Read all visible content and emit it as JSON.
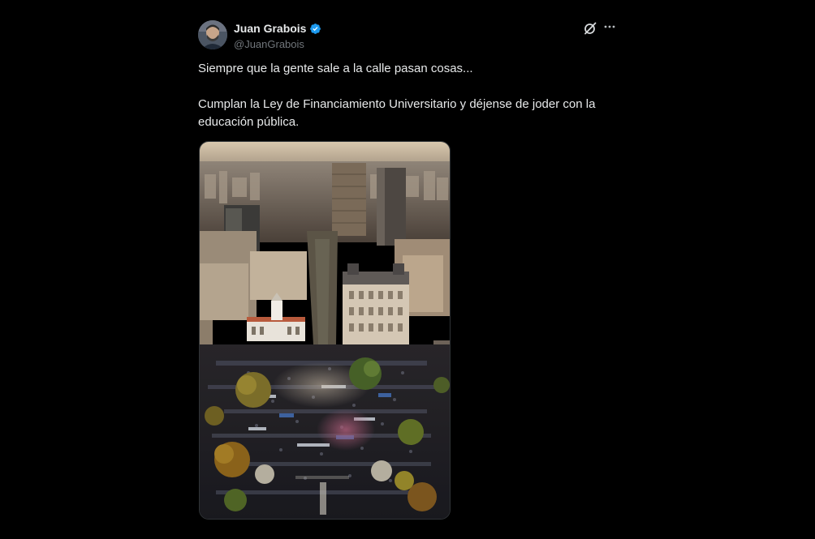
{
  "tweet": {
    "author": {
      "display_name": "Juan Grabois",
      "handle": "@JuanGrabois",
      "verified": true
    },
    "text_line_1": "Siempre que la gente sale a la calle pasan cosas...",
    "text_line_2": "Cumplan la Ley de Financiamiento Universitario y déjense de joder con la educación pública.",
    "media": {
      "kind": "photo",
      "subject": "aerial photo of a large crowd in a city plaza surrounded by buildings"
    }
  },
  "icons": {
    "verified": "verified-badge-icon",
    "grok": "grok-icon",
    "more": "more-options-icon"
  },
  "colors": {
    "background": "#000000",
    "text_primary": "#e7e9ea",
    "text_secondary": "#71767b",
    "verified_blue": "#1d9bf0"
  }
}
